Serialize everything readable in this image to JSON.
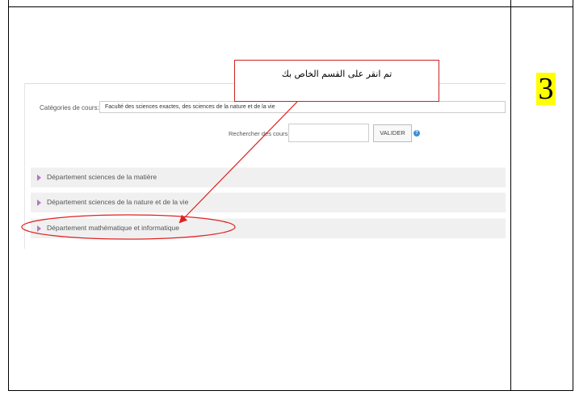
{
  "step": {
    "number": "3"
  },
  "callout": {
    "text": "تم انقر على القسم الخاص بك"
  },
  "form": {
    "category_label": "Catégories de cours:",
    "category_value": "Faculté des sciences exactes, des sciences de la nature et de la vie",
    "search_label": "Rechercher des cours",
    "search_value": "",
    "submit_label": "VALIDER",
    "help_glyph": "?"
  },
  "departments": [
    {
      "label": "Département sciences de la matière"
    },
    {
      "label": "Département sciences de la nature et de la vie"
    },
    {
      "label": "Département mathématique et informatique"
    }
  ],
  "colors": {
    "annotation": "#e02020",
    "expand_icon": "#b576c8",
    "help_icon": "#3a8fd6",
    "step_highlight": "#ffff00"
  }
}
